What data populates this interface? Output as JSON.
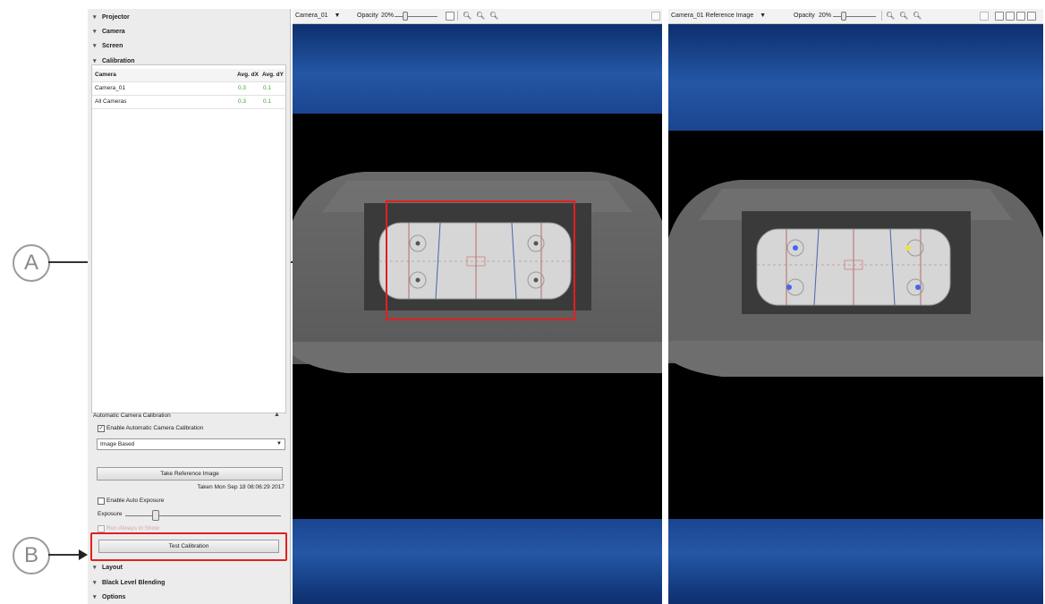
{
  "sidebar": {
    "sections_top": [
      "Projector",
      "Camera",
      "Screen",
      "Calibration"
    ],
    "calibration_table": {
      "headers": [
        "Camera",
        "Avg. dX",
        "Avg. dY"
      ],
      "rows": [
        {
          "camera": "Camera_01",
          "dx": "0.3",
          "dy": "0.1"
        },
        {
          "camera": "All Cameras",
          "dx": "0.3",
          "dy": "0.1"
        }
      ]
    },
    "auto_calibration": {
      "title": "Automatic Camera Calibration",
      "enable_label": "Enable Automatic Camera Calibration",
      "mode_value": "Image Based",
      "take_reference_label": "Take Reference Image",
      "taken_text": "Taken Mon Sep 18 08:06:29 2017",
      "auto_exposure_label": "Enable Auto Exposure",
      "exposure_label": "Exposure",
      "hidden_option_label": "Run Always in Show",
      "test_calibration_label": "Test Calibration"
    },
    "sections_bottom": [
      "Layout",
      "Black Level Blending",
      "Options"
    ]
  },
  "viewport_left": {
    "camera_name": "Camera_01",
    "opacity_label": "Opacity",
    "opacity_value": "20%"
  },
  "viewport_right": {
    "camera_name": "Camera_01 Reference Image",
    "opacity_label": "Opacity",
    "opacity_value": "20%"
  },
  "callouts": {
    "a": "A",
    "b": "B"
  },
  "colors": {
    "highlight": "#e02020",
    "sky": "#1e4a96",
    "green_value": "#3aa53a"
  }
}
